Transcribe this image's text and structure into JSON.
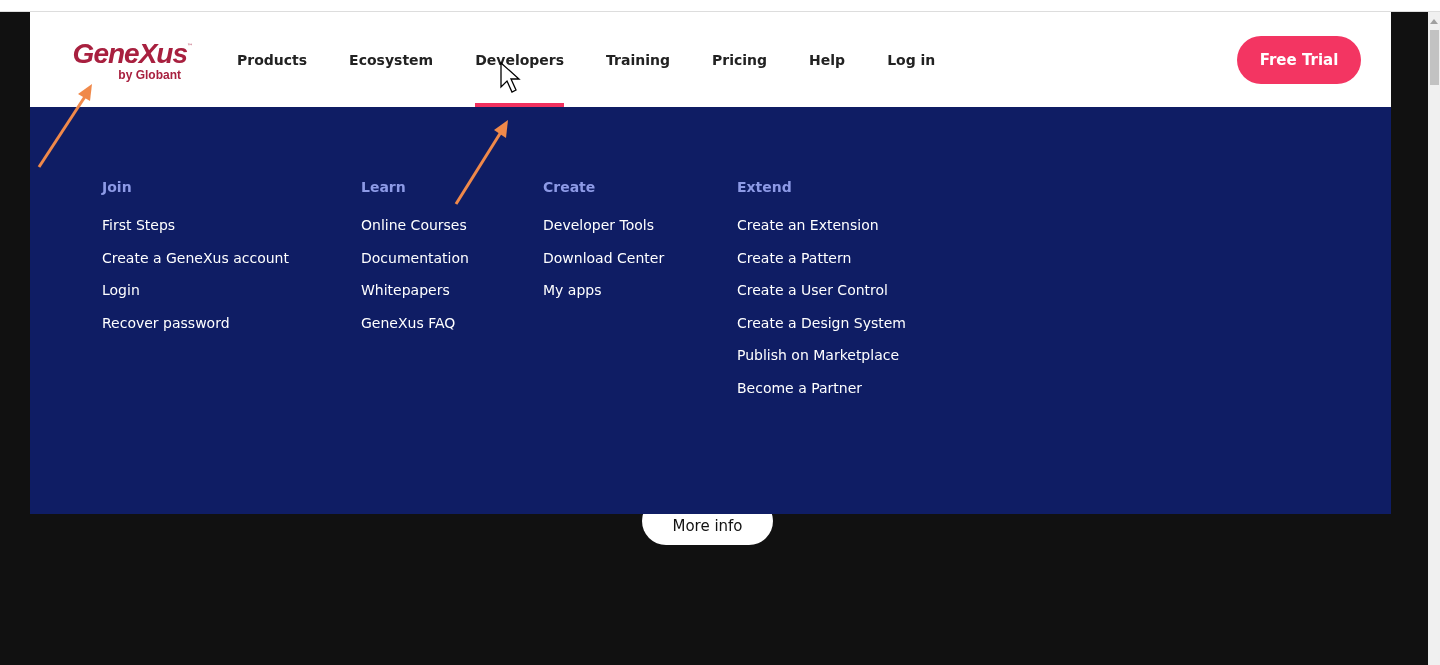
{
  "logo": {
    "brand": "GeneXus",
    "trademark": "™",
    "tagline": "by Globant"
  },
  "nav": [
    {
      "label": "Products",
      "selected": false
    },
    {
      "label": "Ecosystem",
      "selected": false
    },
    {
      "label": "Developers",
      "selected": true
    },
    {
      "label": "Training",
      "selected": false
    },
    {
      "label": "Pricing",
      "selected": false
    },
    {
      "label": "Help",
      "selected": false
    },
    {
      "label": "Log in",
      "selected": false
    }
  ],
  "cta": "Free Trial",
  "menu": [
    {
      "heading": "Join",
      "links": [
        "First Steps",
        "Create a GeneXus account",
        "Login",
        "Recover password"
      ]
    },
    {
      "heading": "Learn",
      "links": [
        "Online Courses",
        "Documentation",
        "Whitepapers",
        "GeneXus FAQ"
      ]
    },
    {
      "heading": "Create",
      "links": [
        "Developer Tools",
        "Download Center",
        "My apps"
      ]
    },
    {
      "heading": "Extend",
      "links": [
        "Create an Extension",
        "Create a Pattern",
        "Create a User Control",
        "Create a Design System",
        "Publish on Marketplace",
        "Become a Partner"
      ]
    }
  ],
  "more_info": "More info"
}
